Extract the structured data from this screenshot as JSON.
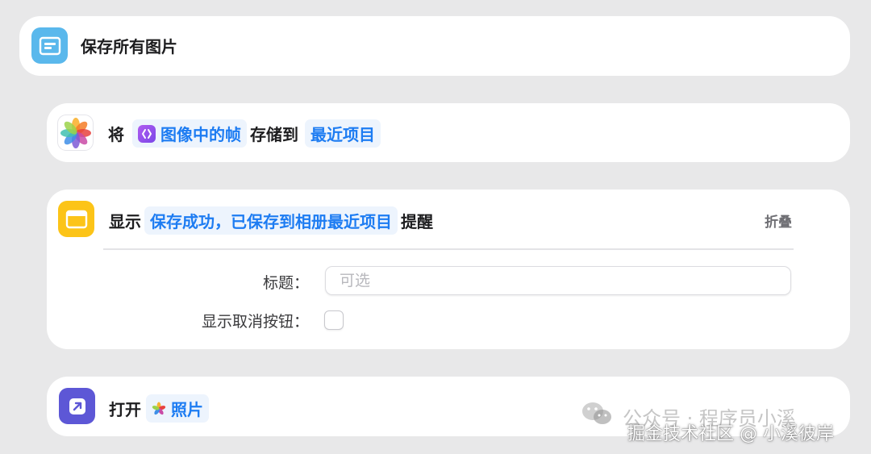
{
  "header": {
    "title": "保存所有图片",
    "icon": "shortcut-window-icon",
    "icon_color": "#5ab8ec"
  },
  "save_action": {
    "prefix": "将",
    "input_token": "图像中的帧",
    "input_token_icon": "shortcuts-magic-variable-icon",
    "middle": "存储到",
    "album_token": "最近项目",
    "icon": "photos-app-icon"
  },
  "alert_action": {
    "prefix": "显示",
    "message_token": "保存成功，已保存到相册最近项目",
    "suffix": "提醒",
    "collapse_label": "折叠",
    "title_label": "标题：",
    "title_placeholder": "可选",
    "cancel_label": "显示取消按钮：",
    "cancel_checked": false,
    "icon": "alert-window-icon",
    "icon_color": "#fcc418"
  },
  "open_action": {
    "prefix": "打开",
    "app_token": "照片",
    "icon": "open-app-icon",
    "icon_color": "#5d57d6"
  },
  "watermark": {
    "line1": "公众号 · 程序员小溪",
    "line2": "掘金技术社区 @ 小溪彼岸"
  }
}
